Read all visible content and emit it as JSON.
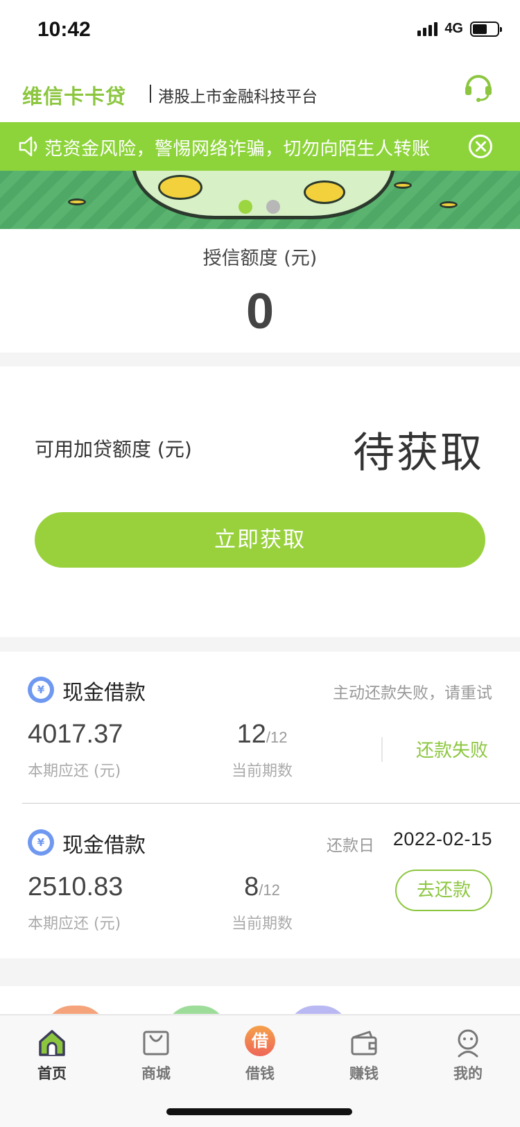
{
  "status_bar": {
    "time": "10:42",
    "network": "4G",
    "battery_level": 0.6
  },
  "header": {
    "brand": "维信卡卡贷",
    "slogan": "港股上市金融科技平台",
    "service_icon": "headset-icon"
  },
  "notice": {
    "text": "范资金风险，警惕网络诈骗，切勿向陌生人转账",
    "close_icon": "close-circle-icon"
  },
  "banner": {
    "slides": 2,
    "active_slide": 1
  },
  "credit": {
    "label": "授信额度 (元)",
    "value": "0"
  },
  "addon": {
    "label": "可用加贷额度 (元)",
    "value": "待获取",
    "button": "立即获取"
  },
  "loans": [
    {
      "title": "现金借款",
      "note": "主动还款失败，请重试",
      "amount": "4017.37",
      "amount_label": "本期应还 (元)",
      "period_current": "12",
      "period_total": "/12",
      "period_label": "当前期数",
      "status": "还款失败"
    },
    {
      "title": "现金借款",
      "due_label": "还款日",
      "due_date": "2022-02-15",
      "amount": "2510.83",
      "amount_label": "本期应还 (元)",
      "period_current": "8",
      "period_total": "/12",
      "period_label": "当前期数",
      "action": "去还款"
    }
  ],
  "tabbar": {
    "items": [
      {
        "label": "首页",
        "icon": "home-icon",
        "active": true
      },
      {
        "label": "商城",
        "icon": "shopping-bag-icon",
        "active": false
      },
      {
        "label": "借钱",
        "icon": "borrow-icon",
        "badge_char": "借",
        "active": false
      },
      {
        "label": "赚钱",
        "icon": "wallet-icon",
        "active": false
      },
      {
        "label": "我的",
        "icon": "profile-icon",
        "active": false
      }
    ]
  },
  "colors": {
    "accent": "#99d13d",
    "brand_green": "#8cc63f",
    "notice_bg": "#8dd43a",
    "yen_blue": "#6f98f0"
  }
}
